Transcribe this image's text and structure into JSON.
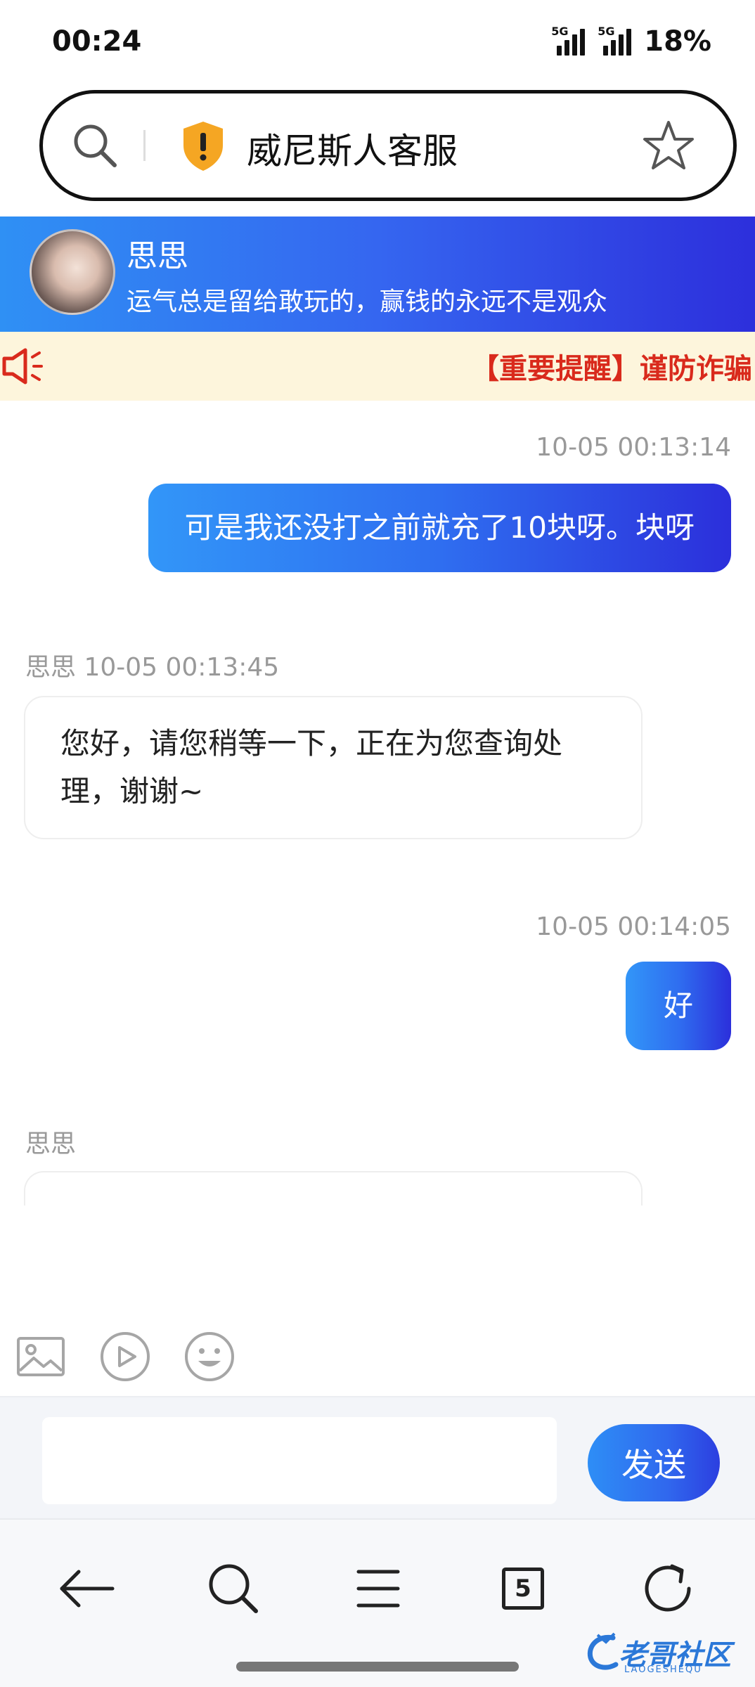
{
  "status_bar": {
    "time": "00:24",
    "signal1_label": "5G",
    "signal2_label": "5G",
    "battery": "18%"
  },
  "address_bar": {
    "title": "威尼斯人客服",
    "icons": [
      "search-icon",
      "shield-icon",
      "star-icon"
    ],
    "shield_color": "#f5a623"
  },
  "agent": {
    "name": "思思",
    "motto": "运气总是留给敢玩的，赢钱的永远不是观众"
  },
  "notice": {
    "text": "【重要提醒】谨防诈骗",
    "color": "#d92a1c"
  },
  "messages": [
    {
      "side": "out",
      "timestamp": "10-05 00:13:14",
      "text": "可是我还没打之前就充了10块呀。块呀"
    },
    {
      "side": "in",
      "header": "思思 10-05 00:13:45",
      "text": "您好，请您稍等一下，正在为您查询处理，谢谢~"
    },
    {
      "side": "out",
      "timestamp": "10-05 00:14:05",
      "text": "好"
    },
    {
      "side": "in",
      "header": "思思"
    }
  ],
  "toolbar": {
    "icons": [
      "image-icon",
      "video-icon",
      "emoji-icon"
    ]
  },
  "composer": {
    "placeholder": "",
    "send_label": "发送"
  },
  "browser_nav": {
    "icons": [
      "back-arrow-icon",
      "search-icon",
      "menu-icon",
      "tabs-icon",
      "refresh-icon"
    ],
    "tab_count": "5"
  },
  "watermark": {
    "text": "老哥社区",
    "sub": "LAOGESHEQU"
  },
  "colors": {
    "accent_gradient_start": "#2f90f4",
    "accent_gradient_end": "#2d2fdc",
    "notice_bg": "#fdf5dc"
  }
}
